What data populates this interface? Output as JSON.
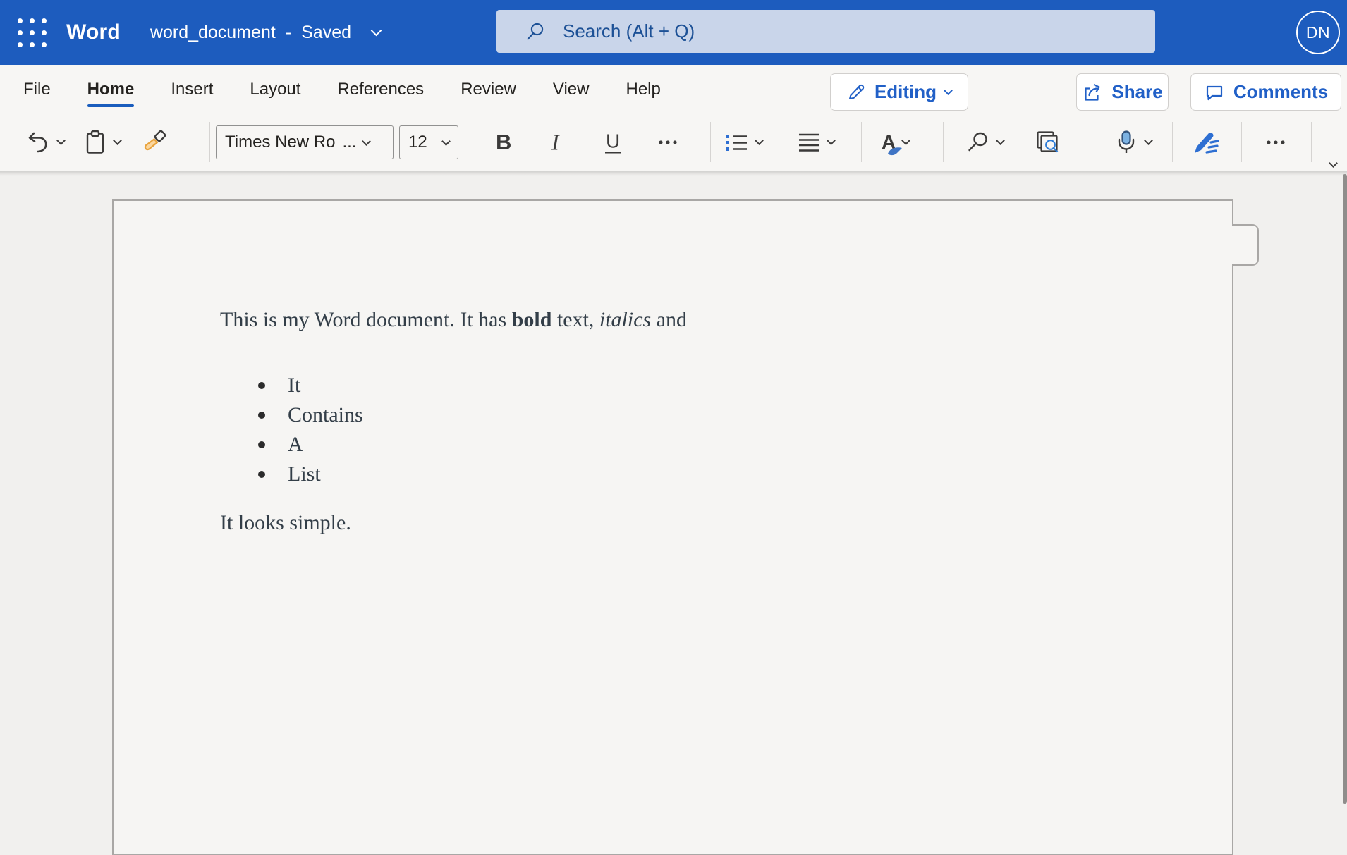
{
  "header": {
    "app_name": "Word",
    "document_name": "word_document",
    "separator": "-",
    "save_status": "Saved",
    "search_placeholder": "Search (Alt + Q)",
    "avatar_initials": "DN"
  },
  "menu": {
    "items": [
      "File",
      "Home",
      "Insert",
      "Layout",
      "References",
      "Review",
      "View",
      "Help"
    ],
    "active_item": "Home",
    "editing_button": "Editing",
    "share_button": "Share",
    "comments_button": "Comments"
  },
  "toolbar": {
    "font_name": "Times New Ro",
    "font_name_truncation": "...",
    "font_size": "12",
    "bold_label": "B",
    "italic_label": "I",
    "underline_label": "U",
    "styles_letter": "A"
  },
  "document": {
    "paragraph1": {
      "text_start": "This is my Word document. It has ",
      "bold_text": "bold",
      "text_mid": " text, ",
      "italic_text": "italics",
      "text_end": " and"
    },
    "list_items": [
      "It",
      "Contains",
      "A",
      "List"
    ],
    "paragraph2": "It looks simple."
  },
  "icons": {
    "app_launcher": "3x3-dot-grid",
    "title_chevron": "chevron-down",
    "search": "magnifying-glass",
    "editing_pen": "pencil-outline",
    "share": "box-with-up-right-arrow",
    "comments": "speech-bubble",
    "undo": "curved-arrow-left",
    "paste": "clipboard",
    "format_painter": "paintbrush-orange",
    "more_formatting": "ellipsis",
    "bullet_list": "list-with-blue-squares",
    "alignment": "justify-lines",
    "styles": "letter-A-with-blue-brush",
    "find": "magnifying-glass",
    "page_find": "stacked-pages-with-blue-magnifier",
    "dictate": "blue-microphone",
    "editor": "blue-pen-with-lines",
    "more_commands": "ellipsis",
    "collapse_ribbon": "chevron-down",
    "scrollbar": "vertical-thumb"
  },
  "colors": {
    "header_bar": "#1d5cbe",
    "accent_blue": "#1a5dbd",
    "button_blue": "#2160c7",
    "search_box_bg": "#c9d5ea",
    "search_box_fg": "#1d5196",
    "ribbon_bg": "#f7f6f4",
    "canvas_bg": "#f1f0ee",
    "page_bg": "#f6f5f3",
    "page_border": "#a9a7a5",
    "document_text": "#333e48",
    "toolbar_icon": "#3b3a39",
    "format_painter_orange": "#e8a33d"
  }
}
